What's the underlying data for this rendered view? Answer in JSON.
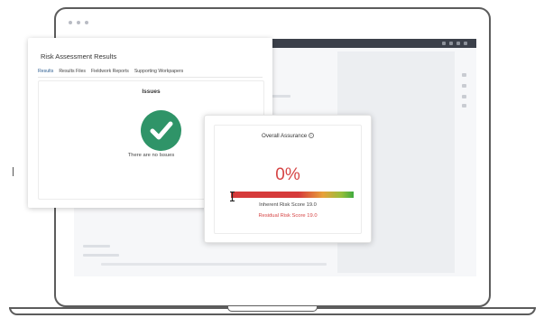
{
  "risk_card": {
    "title": "Risk Assessment Results",
    "tabs": [
      {
        "label": "Results",
        "active": true
      },
      {
        "label": "Results Files",
        "active": false
      },
      {
        "label": "Fieldwork Reports",
        "active": false
      },
      {
        "label": "Supporting Workpapers",
        "active": false
      }
    ],
    "issues_heading": "Issues",
    "status_icon": "check-circle-icon",
    "status_text": "There are no Issues"
  },
  "assurance": {
    "title": "Overall Assurance",
    "value": "0%",
    "level": 0,
    "inherent": "Inherent Risk Score 19.0",
    "residual": "Residual Risk Score 19.0"
  },
  "colors": {
    "accent": "#4a7fb5",
    "success": "#2f9468",
    "danger": "#d64545",
    "laptop_frame": "#5c5c5c"
  }
}
